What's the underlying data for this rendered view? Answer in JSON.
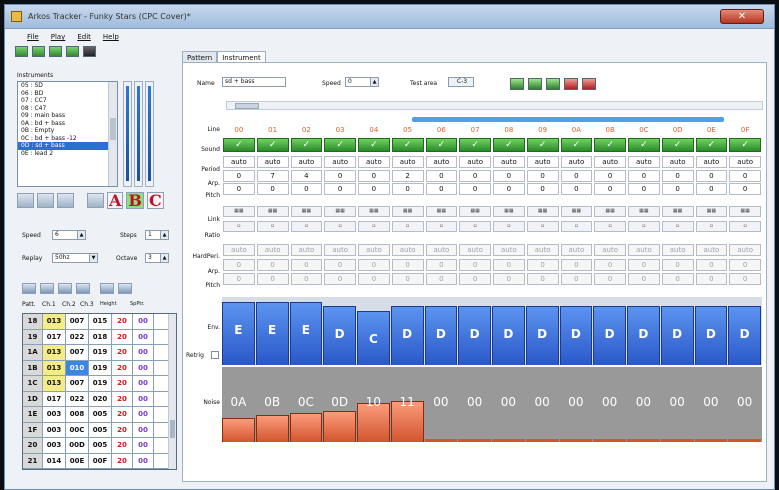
{
  "window": {
    "title": "Arkos Tracker - Funky Stars (CPC Cover)*"
  },
  "menu": [
    "File",
    "Play",
    "Edit",
    "Help"
  ],
  "instruments": {
    "label": "Instruments",
    "items": [
      "05 : SD",
      "06 : BD",
      "07 : CC7",
      "08 : C47",
      "09 : main bass",
      "0A : bd + bass",
      "0B : Empty",
      "0C : bd + bass -12",
      "0D : sd + bass",
      "0E : lead 2"
    ],
    "selected_index": 8
  },
  "left": {
    "speed_label": "Speed",
    "speed_value": "6",
    "steps_label": "Steps",
    "steps_value": "1",
    "replay_label": "Replay",
    "replay_value": "50hz",
    "octave_label": "Octave",
    "octave_value": "3"
  },
  "pattern_header": [
    "Patt.",
    "Ch.1",
    "Ch.2",
    "Ch.3",
    "Height",
    "SpPtr."
  ],
  "pattern_rows": [
    [
      "18",
      "013",
      "007",
      "015",
      "20",
      "00"
    ],
    [
      "19",
      "017",
      "022",
      "018",
      "20",
      "00"
    ],
    [
      "1A",
      "013",
      "007",
      "019",
      "20",
      "00"
    ],
    [
      "1B",
      "013",
      "010",
      "019",
      "20",
      "00"
    ],
    [
      "1C",
      "013",
      "007",
      "019",
      "20",
      "00"
    ],
    [
      "1D",
      "017",
      "022",
      "020",
      "20",
      "00"
    ],
    [
      "1E",
      "003",
      "008",
      "005",
      "20",
      "00"
    ],
    [
      "1F",
      "003",
      "00C",
      "005",
      "20",
      "00"
    ],
    [
      "20",
      "003",
      "00D",
      "005",
      "20",
      "00"
    ],
    [
      "21",
      "014",
      "00E",
      "00F",
      "20",
      "00"
    ]
  ],
  "tabs": [
    "Pattern",
    "Instrument"
  ],
  "instrument": {
    "name_label": "Name",
    "name_value": "sd + bass",
    "speed_label": "Speed",
    "speed_value": "0",
    "test_area_label": "Test area",
    "test_area_value": "C-3"
  },
  "row_labels": {
    "line": "Line",
    "sound": "Sound",
    "period": "Period",
    "arp": "Arp.",
    "pitch": "Pitch",
    "link": "Link",
    "ratio": "Ratio",
    "hardper": "HardPeri.",
    "arp2": "Arp.",
    "pitch2": "Pitch",
    "env": "Env.",
    "retrig": "Retrig",
    "noise": "Noise"
  },
  "lines": [
    "00",
    "01",
    "02",
    "03",
    "04",
    "05",
    "06",
    "07",
    "08",
    "09",
    "0A",
    "0B",
    "0C",
    "0D",
    "0E",
    "0F"
  ],
  "period": "auto",
  "arp": [
    "0",
    "7",
    "4",
    "0",
    "0",
    "2",
    "0",
    "0",
    "0",
    "0",
    "0",
    "0",
    "0",
    "0",
    "0",
    "0"
  ],
  "pitch": [
    "0",
    "0",
    "0",
    "0",
    "0",
    "0",
    "0",
    "0",
    "0",
    "0",
    "0",
    "0",
    "0",
    "0",
    "0",
    "0"
  ],
  "env": [
    "E",
    "E",
    "E",
    "D",
    "C",
    "D",
    "D",
    "D",
    "D",
    "D",
    "D",
    "D",
    "D",
    "D",
    "D",
    "D"
  ],
  "env_levels": [
    14,
    14,
    14,
    13,
    12,
    13,
    13,
    13,
    13,
    13,
    13,
    13,
    13,
    13,
    13,
    13
  ],
  "noise": [
    "0A",
    "0B",
    "0C",
    "0D",
    "10",
    "11",
    "00",
    "00",
    "00",
    "00",
    "00",
    "00",
    "00",
    "00",
    "00",
    "00"
  ],
  "noise_levels": [
    10,
    11,
    12,
    13,
    16,
    17,
    0,
    0,
    0,
    0,
    0,
    0,
    0,
    0,
    0,
    0
  ]
}
